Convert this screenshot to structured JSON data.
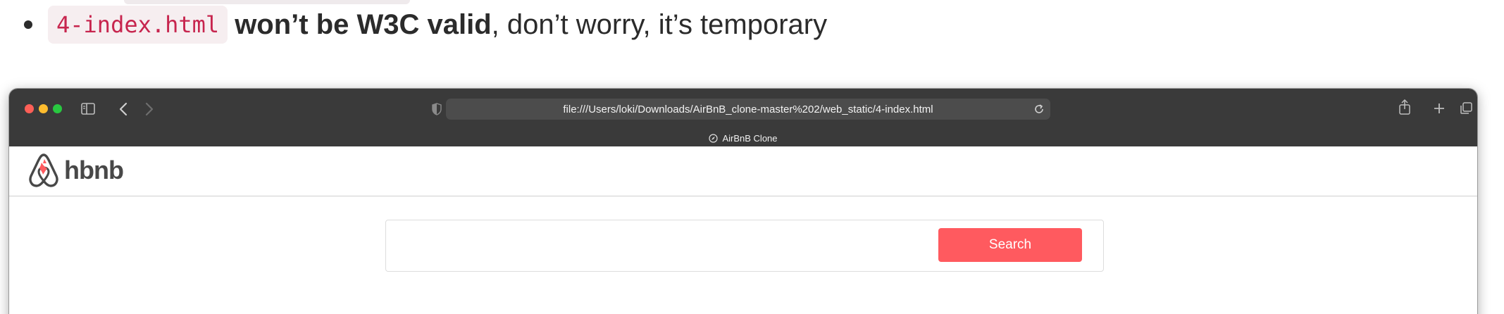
{
  "doc": {
    "code": "4-index.html",
    "bold": "won’t be W3C valid",
    "rest": ", don’t worry, it’s temporary"
  },
  "browser": {
    "url": "file:///Users/loki/Downloads/AirBnB_clone-master%202/web_static/4-index.html",
    "tab_title": "AirBnB Clone"
  },
  "site": {
    "logo_text": "hbnb",
    "search_label": "Search"
  },
  "colors": {
    "accent": "#ff5a5f",
    "toolbar": "#3a3a3a",
    "code_text": "#c7254e"
  },
  "icons": [
    "sidebar-icon",
    "back-icon",
    "forward-icon",
    "shield-icon",
    "reload-icon",
    "share-icon",
    "new-tab-icon",
    "tab-overview-icon",
    "compass-icon",
    "airbnb-logo-icon"
  ]
}
